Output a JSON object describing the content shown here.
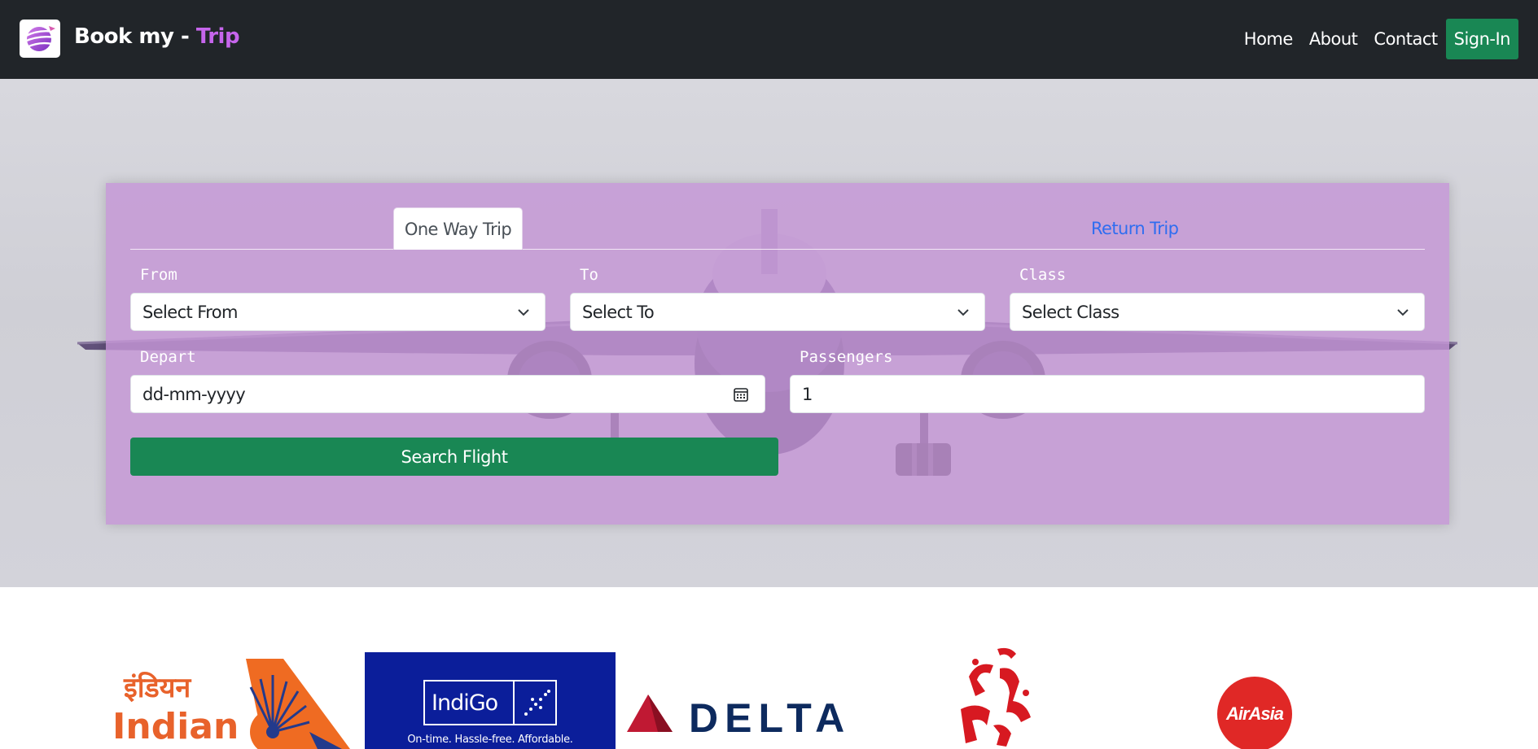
{
  "navbar": {
    "brand_prefix": "Book my - ",
    "brand_accent": "Trip",
    "links": [
      "Home",
      "About",
      "Contact"
    ],
    "signin_label": "Sign-In"
  },
  "search": {
    "tabs": {
      "one_way": "One Way Trip",
      "return": "Return Trip"
    },
    "from": {
      "label": "From",
      "value": "Select From"
    },
    "to": {
      "label": "To",
      "value": "Select To"
    },
    "class": {
      "label": "Class",
      "value": "Select Class"
    },
    "depart": {
      "label": "Depart",
      "value": "dd-mm-yyyy"
    },
    "passengers": {
      "label": "Passengers",
      "value": "1"
    },
    "button_label": "Search Flight"
  },
  "airlines": {
    "air_india": {
      "devanagari": "इंडियन",
      "latin": "Indian"
    },
    "indigo": {
      "name": "IndiGo",
      "tagline": "On-time. Hassle-free. Affordable."
    },
    "delta": {
      "name": "DELTA"
    },
    "airasia": {
      "name": "AirAsia"
    }
  },
  "colors": {
    "navbar_bg": "#212529",
    "brand_accent": "#c665ec",
    "success": "#198754",
    "link": "#2f6df0",
    "panel_bg": "#c496d6"
  }
}
